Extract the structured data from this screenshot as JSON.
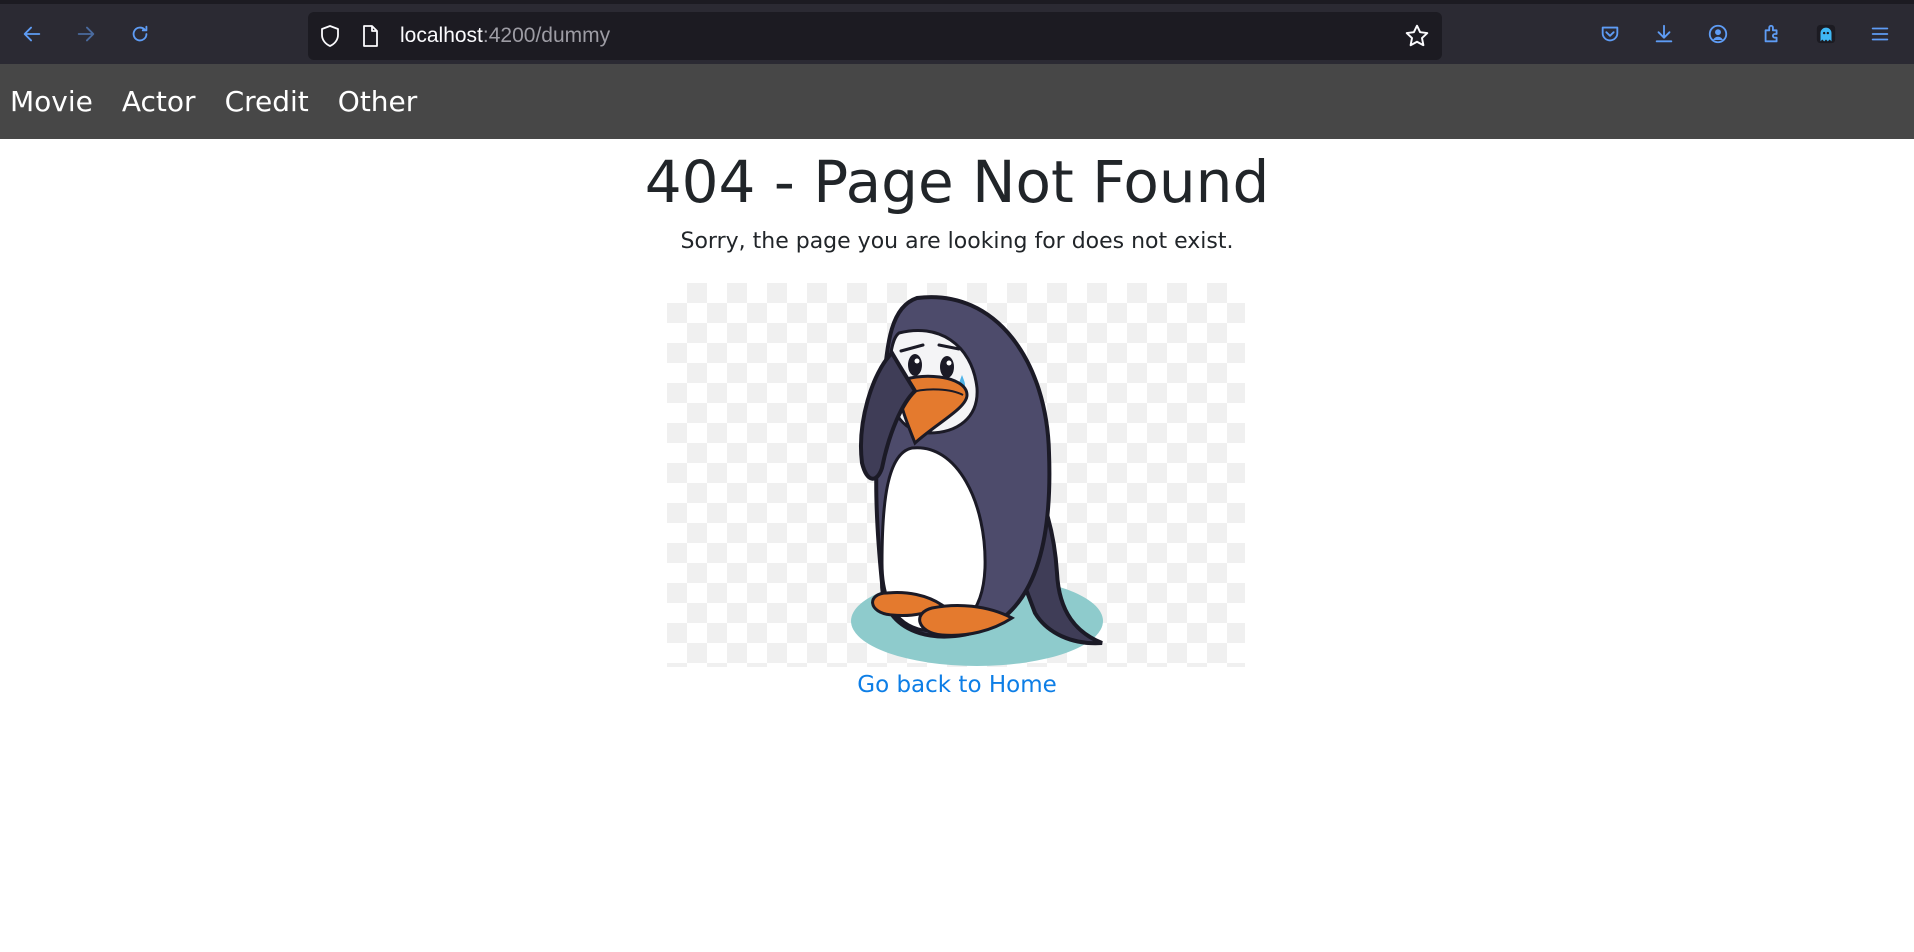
{
  "browser": {
    "url_host": "localhost",
    "url_rest": ":4200/dummy",
    "accent": "#5e9cf5",
    "icons": [
      "back-icon",
      "forward-icon",
      "reload-icon",
      "shield-icon",
      "page-icon",
      "bookmark-star-icon",
      "pocket-icon",
      "download-icon",
      "account-icon",
      "extensions-icon",
      "ghost-extension-icon",
      "menu-icon"
    ]
  },
  "nav": {
    "items": [
      {
        "label": "Movie"
      },
      {
        "label": "Actor"
      },
      {
        "label": "Credit"
      },
      {
        "label": "Other"
      }
    ],
    "background": "#474747"
  },
  "main": {
    "title": "404 - Page Not Found",
    "message": "Sorry, the page you are looking for does not exist.",
    "link_label": "Go back to Home",
    "link_color": "#0d7ee6"
  }
}
